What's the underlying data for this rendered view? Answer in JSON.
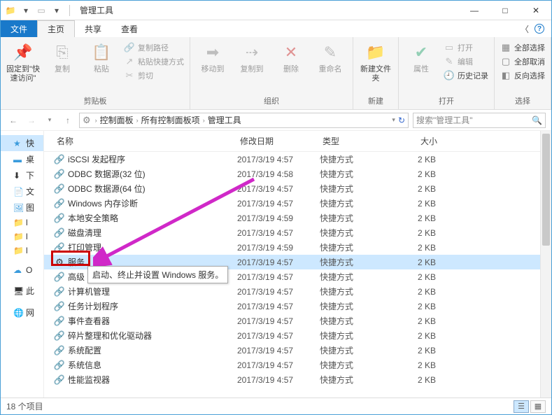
{
  "window": {
    "title": "管理工具",
    "min": "—",
    "max": "□",
    "close": "✕"
  },
  "tabs": {
    "file": "文件",
    "home": "主页",
    "share": "共享",
    "view": "查看"
  },
  "ribbon": {
    "pin": "固定到\"快速访问\"",
    "copy": "复制",
    "paste": "粘贴",
    "copy_path": "复制路径",
    "paste_shortcut": "粘贴快捷方式",
    "cut": "剪切",
    "group_clipboard": "剪贴板",
    "move_to": "移动到",
    "copy_to": "复制到",
    "delete": "删除",
    "rename": "重命名",
    "group_organize": "组织",
    "new_folder": "新建文件夹",
    "group_new": "新建",
    "properties": "属性",
    "open": "打开",
    "edit": "编辑",
    "history": "历史记录",
    "group_open": "打开",
    "select_all": "全部选择",
    "select_none": "全部取消",
    "invert_selection": "反向选择",
    "group_select": "选择"
  },
  "breadcrumb": {
    "parts": [
      "控制面板",
      "所有控制面板项",
      "管理工具"
    ],
    "refresh": "↻"
  },
  "search": {
    "placeholder": "搜索\"管理工具\""
  },
  "nav": {
    "quick": "快",
    "desktop": "桌",
    "downloads": "下",
    "documents": "文",
    "pictures": "图",
    "folder1": "l",
    "folder2": "l",
    "folder3": "l",
    "onedrive": "O",
    "thispc": "此",
    "network": "网"
  },
  "columns": {
    "name": "名称",
    "date": "修改日期",
    "type": "类型",
    "size": "大小"
  },
  "files": [
    {
      "icon": "🔗",
      "name": "iSCSI 发起程序",
      "date": "2017/3/19 4:57",
      "type": "快捷方式",
      "size": "2 KB"
    },
    {
      "icon": "🔗",
      "name": "ODBC 数据源(32 位)",
      "date": "2017/3/19 4:58",
      "type": "快捷方式",
      "size": "2 KB"
    },
    {
      "icon": "🔗",
      "name": "ODBC 数据源(64 位)",
      "date": "2017/3/19 4:57",
      "type": "快捷方式",
      "size": "2 KB"
    },
    {
      "icon": "🔗",
      "name": "Windows 内存诊断",
      "date": "2017/3/19 4:57",
      "type": "快捷方式",
      "size": "2 KB"
    },
    {
      "icon": "🔗",
      "name": "本地安全策略",
      "date": "2017/3/19 4:59",
      "type": "快捷方式",
      "size": "2 KB"
    },
    {
      "icon": "🔗",
      "name": "磁盘清理",
      "date": "2017/3/19 4:57",
      "type": "快捷方式",
      "size": "2 KB"
    },
    {
      "icon": "🔗",
      "name": "打印管理",
      "date": "2017/3/19 4:59",
      "type": "快捷方式",
      "size": "2 KB"
    },
    {
      "icon": "⚙",
      "name": "服务",
      "date": "2017/3/19 4:57",
      "type": "快捷方式",
      "size": "2 KB",
      "sel": true
    },
    {
      "icon": "🔗",
      "name": "高级",
      "date": "2017/3/19 4:57",
      "type": "快捷方式",
      "size": "2 KB"
    },
    {
      "icon": "🔗",
      "name": "计算机管理",
      "date": "2017/3/19 4:57",
      "type": "快捷方式",
      "size": "2 KB"
    },
    {
      "icon": "🔗",
      "name": "任务计划程序",
      "date": "2017/3/19 4:57",
      "type": "快捷方式",
      "size": "2 KB"
    },
    {
      "icon": "🔗",
      "name": "事件查看器",
      "date": "2017/3/19 4:57",
      "type": "快捷方式",
      "size": "2 KB"
    },
    {
      "icon": "🔗",
      "name": "碎片整理和优化驱动器",
      "date": "2017/3/19 4:57",
      "type": "快捷方式",
      "size": "2 KB"
    },
    {
      "icon": "🔗",
      "name": "系统配置",
      "date": "2017/3/19 4:57",
      "type": "快捷方式",
      "size": "2 KB"
    },
    {
      "icon": "🔗",
      "name": "系统信息",
      "date": "2017/3/19 4:57",
      "type": "快捷方式",
      "size": "2 KB"
    },
    {
      "icon": "🔗",
      "name": "性能监视器",
      "date": "2017/3/19 4:57",
      "type": "快捷方式",
      "size": "2 KB"
    }
  ],
  "tooltip": "启动、终止并设置 Windows 服务。",
  "status": {
    "count": "18 个项目"
  }
}
